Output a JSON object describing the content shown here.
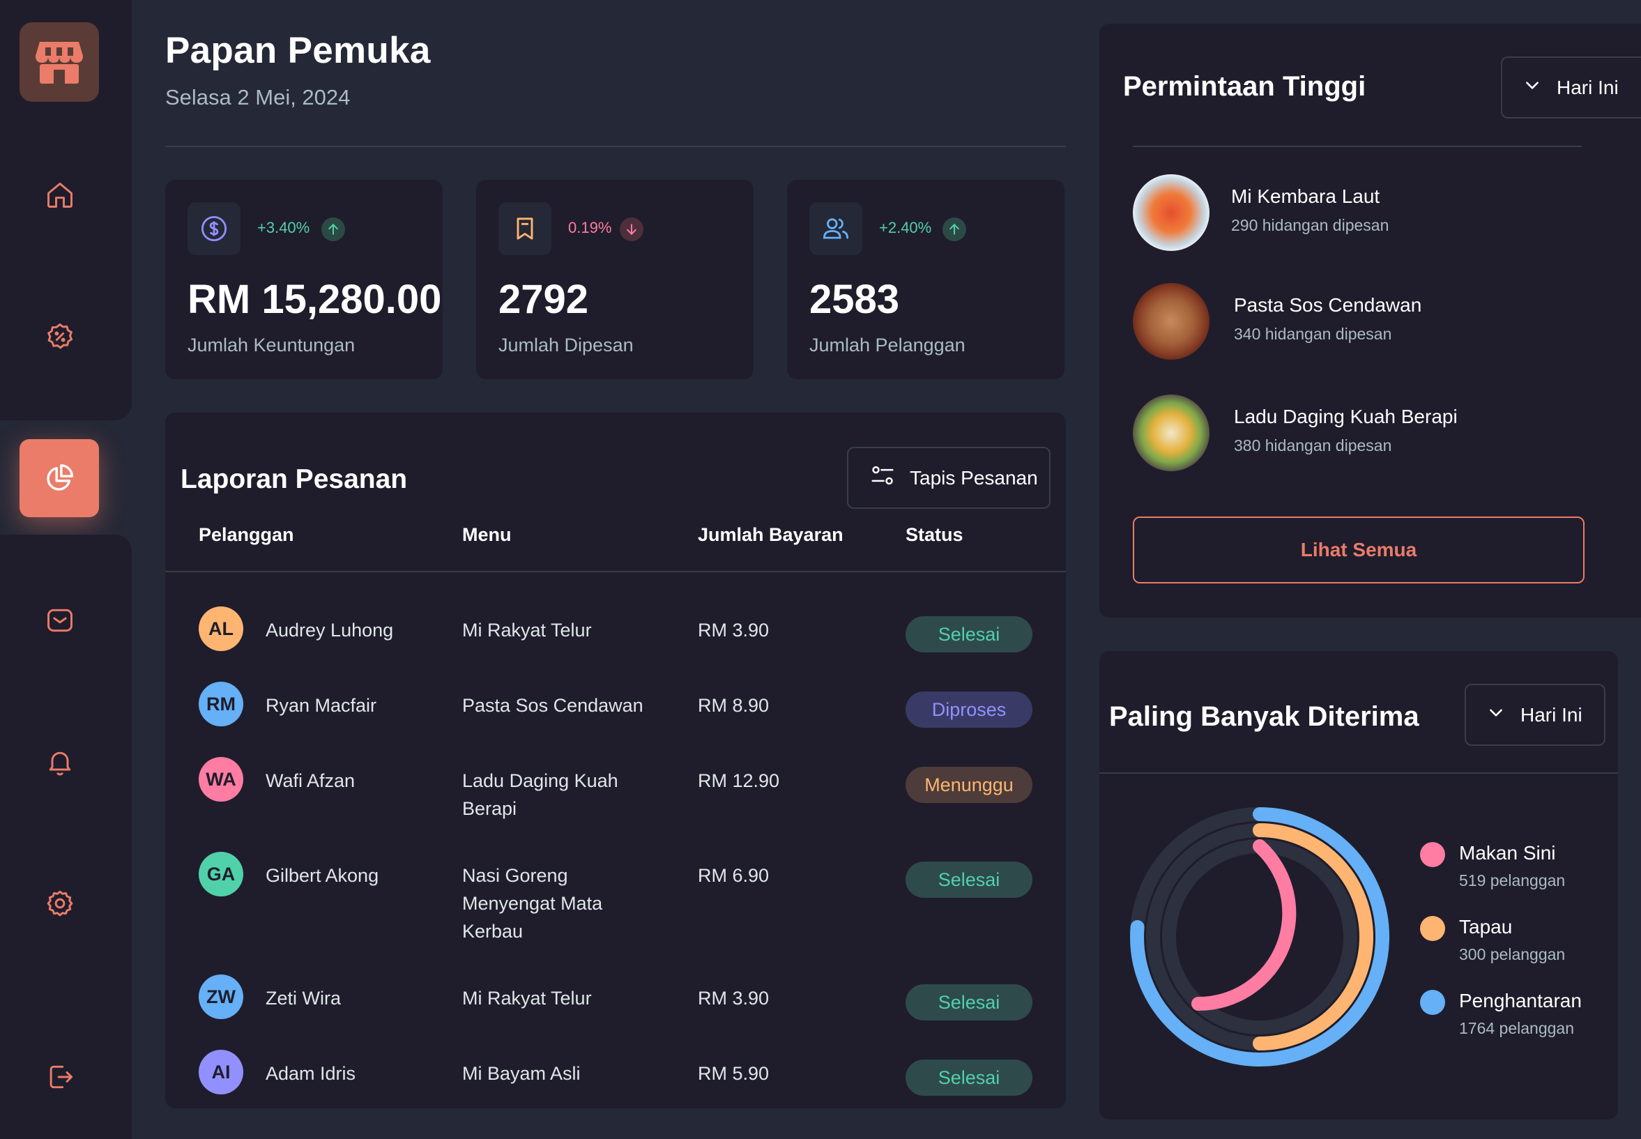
{
  "colors": {
    "accent": "#ea7c69",
    "success": "#50d1aa",
    "danger": "#ff7ca3",
    "processing": "#9290fe",
    "waiting": "#ffb572",
    "panel": "#1f1d2b",
    "background": "#252836"
  },
  "sidebar": {
    "logo_icon": "store-icon",
    "items": [
      {
        "icon": "home-icon"
      },
      {
        "icon": "discount-icon"
      },
      {
        "icon": "dashboard-pie-icon",
        "active": true
      },
      {
        "icon": "message-icon"
      },
      {
        "icon": "notification-icon"
      },
      {
        "icon": "settings-icon"
      },
      {
        "icon": "logout-icon"
      }
    ]
  },
  "header": {
    "title": "Papan Pemuka",
    "date": "Selasa 2 Mei, 2024"
  },
  "stats": [
    {
      "icon": "dollar-icon",
      "change": "+3.40%",
      "trend": "up",
      "value": "RM 15,280.00",
      "label": "Jumlah Keuntungan"
    },
    {
      "icon": "bookmark-icon",
      "change": "0.19%",
      "trend": "down",
      "value": "2792",
      "label": "Jumlah Dipesan"
    },
    {
      "icon": "users-icon",
      "change": "+2.40%",
      "trend": "up",
      "value": "2583",
      "label": "Jumlah Pelanggan"
    }
  ],
  "report": {
    "title": "Laporan Pesanan",
    "filter_label": "Tapis Pesanan",
    "columns": [
      "Pelanggan",
      "Menu",
      "Jumlah Bayaran",
      "Status"
    ],
    "rows": [
      {
        "customer": "Audrey Luhong",
        "menu": "Mi Rakyat Telur",
        "payment": "RM 3.90",
        "status": "Selesai",
        "status_type": "done"
      },
      {
        "customer": "Ryan Macfair",
        "menu": "Pasta Sos Cendawan",
        "payment": "RM 8.90",
        "status": "Diproses",
        "status_type": "proc"
      },
      {
        "customer": "Wafi Afzan",
        "menu": "Ladu Daging Kuah Berapi",
        "payment": "RM 12.90",
        "status": "Menunggu",
        "status_type": "wait"
      },
      {
        "customer": "Gilbert Akong",
        "menu": "Nasi Goreng Menyengat Mata Kerbau",
        "payment": "RM 6.90",
        "status": "Selesai",
        "status_type": "done"
      },
      {
        "customer": "Zeti Wira",
        "menu": "Mi Rakyat Telur",
        "payment": "RM 3.90",
        "status": "Selesai",
        "status_type": "done"
      },
      {
        "customer": "Adam Idris",
        "menu": "Mi Bayam Asli",
        "payment": "RM 5.90",
        "status": "Selesai",
        "status_type": "done"
      }
    ]
  },
  "demand": {
    "title": "Permintaan Tinggi",
    "period": "Hari Ini",
    "dishes": [
      {
        "name": "Mi Kembara Laut",
        "orders": "290 hidangan dipesan"
      },
      {
        "name": "Pasta Sos Cendawan",
        "orders": "340 hidangan dipesan"
      },
      {
        "name": "Ladu Daging Kuah Berapi",
        "orders": "380  hidangan dipesan"
      }
    ],
    "see_all": "Lihat Semua"
  },
  "accepted": {
    "title": "Paling Banyak Diterima",
    "period": "Hari Ini",
    "legend": [
      {
        "name": "Makan Sini",
        "count": "519 pelanggan",
        "color": "#ff7ca3"
      },
      {
        "name": "Tapau",
        "count": "300 pelanggan",
        "color": "#ffb572"
      },
      {
        "name": "Penghantaran",
        "count": "1764 pelanggan",
        "color": "#65b0f6"
      }
    ]
  }
}
